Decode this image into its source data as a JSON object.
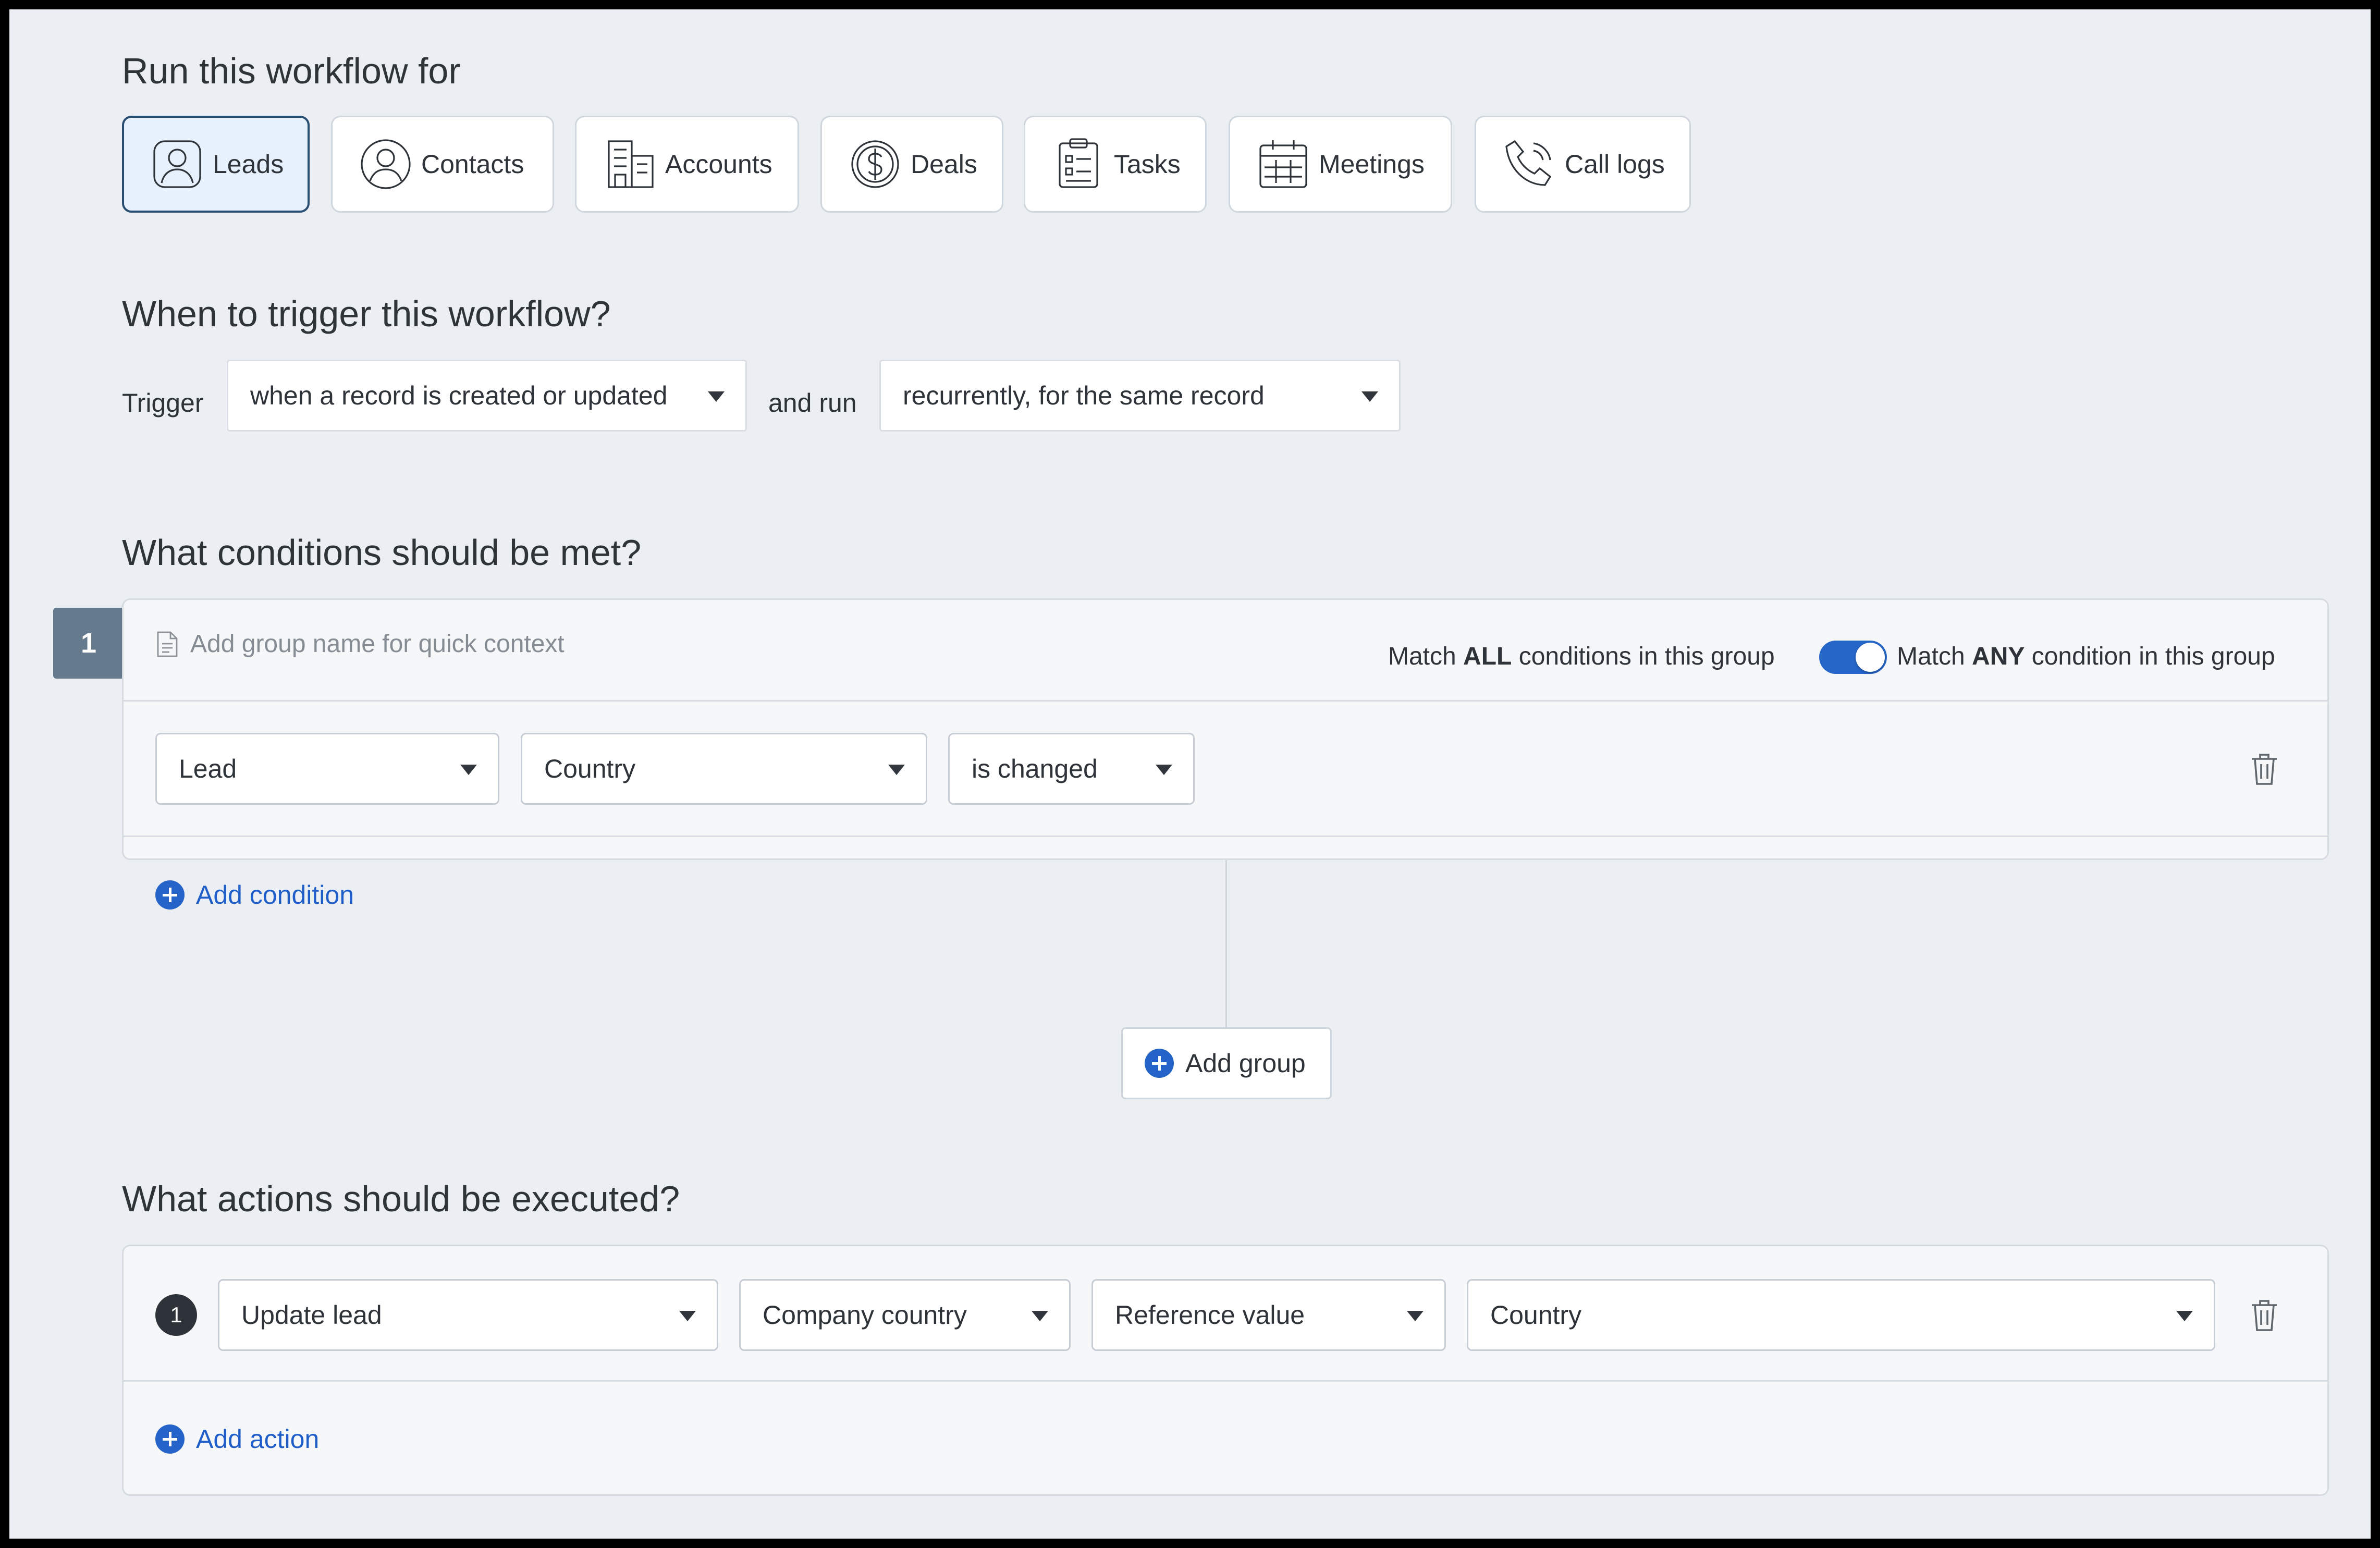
{
  "sections": {
    "run_for": "Run this workflow for",
    "trigger": "When to trigger this workflow?",
    "conditions": "What conditions should be met?",
    "actions": "What actions should be executed?"
  },
  "modules": [
    {
      "label": "Leads",
      "icon": "lead-icon",
      "active": true
    },
    {
      "label": "Contacts",
      "icon": "contact-icon",
      "active": false
    },
    {
      "label": "Accounts",
      "icon": "building-icon",
      "active": false
    },
    {
      "label": "Deals",
      "icon": "dollar-icon",
      "active": false
    },
    {
      "label": "Tasks",
      "icon": "clipboard-icon",
      "active": false
    },
    {
      "label": "Meetings",
      "icon": "calendar-icon",
      "active": false
    },
    {
      "label": "Call logs",
      "icon": "phone-icon",
      "active": false
    }
  ],
  "trigger": {
    "label": "Trigger",
    "when_value": "when a record is created or updated",
    "and_run_label": "and run",
    "run_value": "recurrently, for the same record"
  },
  "condition_group": {
    "number": "1",
    "name_placeholder": "Add group name for quick context",
    "match_all_prefix": "Match ",
    "match_all_keyword": "ALL",
    "match_all_suffix": " conditions in this group",
    "match_any_prefix": "Match ",
    "match_any_keyword": "ANY",
    "match_any_suffix": " condition in this group",
    "toggle_on": true,
    "condition": {
      "entity": "Lead",
      "field": "Country",
      "operator": "is changed"
    },
    "add_condition_label": "Add condition"
  },
  "add_group_label": "Add group",
  "action": {
    "number": "1",
    "type": "Update lead",
    "field": "Company country",
    "value_type": "Reference value",
    "value": "Country",
    "add_action_label": "Add action"
  },
  "colors": {
    "background": "#ebeef2",
    "accent": "#2563c9",
    "active_module_bg": "#e6f1fd",
    "active_module_border": "#2a4d72",
    "badge": "#657a8c"
  }
}
